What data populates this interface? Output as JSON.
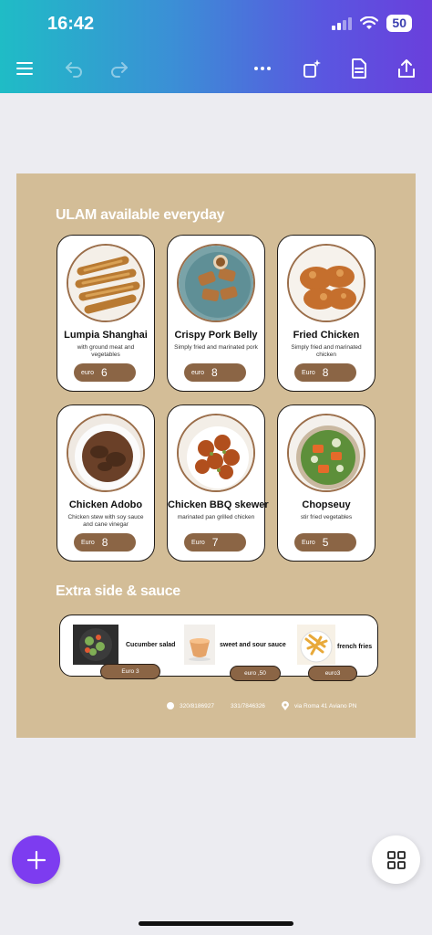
{
  "status_bar": {
    "time": "16:42",
    "battery": "50"
  },
  "toolbar": {
    "menu_icon": "hamburger-icon",
    "undo_icon": "undo-icon",
    "redo_icon": "redo-icon",
    "more_icon": "more-dots-icon",
    "magic_icon": "magic-resize-icon",
    "notes_icon": "document-icon",
    "share_icon": "share-icon"
  },
  "design": {
    "title_main": "ULAM   available everyday",
    "dishes": [
      {
        "name": "Lumpia Shanghai",
        "desc": "with ground meat and vegetables",
        "currency": "euro",
        "price": "6"
      },
      {
        "name": "Crispy Pork Belly",
        "desc": "Simply fried and marinated pork",
        "currency": "euro",
        "price": "8"
      },
      {
        "name": "Fried Chicken",
        "desc": "Simply fried and marinated chicken",
        "currency": "Euro",
        "price": "8"
      },
      {
        "name": "Chicken Adobo",
        "desc": "Chicken stew with soy sauce and cane vinegar",
        "currency": "Euro",
        "price": "8"
      },
      {
        "name": "Chicken BBQ skewer",
        "desc": "marinated pan grilled chicken",
        "currency": "Euro",
        "price": "7"
      },
      {
        "name": "Chopseuy",
        "desc": "stir fried vegetables",
        "currency": "Euro",
        "price": "5"
      }
    ],
    "title_extras": "Extra side & sauce",
    "extras": [
      {
        "name": "Cucumber salad",
        "price": "Euro  3"
      },
      {
        "name": "sweet and sour sauce",
        "price": "euro ,50"
      },
      {
        "name": "french fries",
        "price": "euro3"
      }
    ],
    "contact": {
      "phone1": "320/8186927",
      "phone2": "331/7846326",
      "address": "via Roma 41 Aviano PN"
    }
  },
  "colors": {
    "canvas": "#d3bd97",
    "price_pill": "#8b6545",
    "fab": "#7d3cf0"
  }
}
